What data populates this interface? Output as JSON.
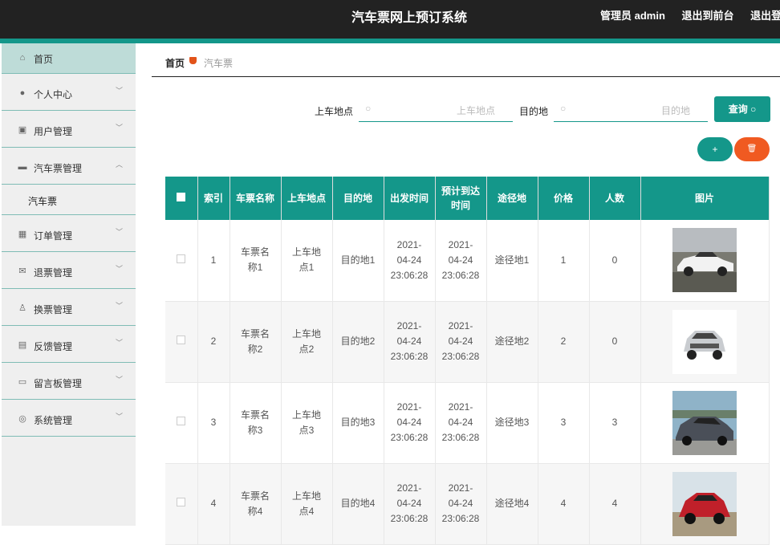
{
  "header": {
    "title": "汽车票网上预订系统",
    "admin_label": "管理员 admin",
    "back_front": "退出到前台",
    "logout": "退出登录"
  },
  "sidebar": {
    "items": [
      {
        "label": "首页",
        "icon": "home-icon"
      },
      {
        "label": "个人中心",
        "icon": "user-icon"
      },
      {
        "label": "用户管理",
        "icon": "clipboard-icon"
      },
      {
        "label": "汽车票管理",
        "icon": "chat-icon"
      },
      {
        "label": "订单管理",
        "icon": "grid-icon"
      },
      {
        "label": "退票管理",
        "icon": "mail-icon"
      },
      {
        "label": "换票管理",
        "icon": "person-icon"
      },
      {
        "label": "反馈管理",
        "icon": "document-icon"
      },
      {
        "label": "留言板管理",
        "icon": "message-icon"
      },
      {
        "label": "系统管理",
        "icon": "gear-icon"
      }
    ],
    "sub_item": "汽车票"
  },
  "breadcrumb": {
    "home": "首页",
    "current": "汽车票"
  },
  "search": {
    "field1_label": "上车地点",
    "field1_placeholder": "上车地点",
    "field2_label": "目的地",
    "field2_placeholder": "目的地",
    "query_label": "查询"
  },
  "actions": {
    "add_label": "+",
    "delete_label": "🗑"
  },
  "table": {
    "headers": [
      "索引",
      "车票名称",
      "上车地点",
      "目的地",
      "出发时间",
      "预计到达时间",
      "途径地",
      "价格",
      "人数",
      "图片"
    ],
    "rows": [
      {
        "index": "1",
        "name": "车票名称1",
        "from": "上车地点1",
        "to": "目的地1",
        "depart": "2021-04-24 23:06:28",
        "arrive": "2021-04-24 23:06:28",
        "via": "途径地1",
        "price": "1",
        "count": "0"
      },
      {
        "index": "2",
        "name": "车票名称2",
        "from": "上车地点2",
        "to": "目的地2",
        "depart": "2021-04-24 23:06:28",
        "arrive": "2021-04-24 23:06:28",
        "via": "途径地2",
        "price": "2",
        "count": "0"
      },
      {
        "index": "3",
        "name": "车票名称3",
        "from": "上车地点3",
        "to": "目的地3",
        "depart": "2021-04-24 23:06:28",
        "arrive": "2021-04-24 23:06:28",
        "via": "途径地3",
        "price": "3",
        "count": "3"
      },
      {
        "index": "4",
        "name": "车票名称4",
        "from": "上车地点4",
        "to": "目的地4",
        "depart": "2021-04-24 23:06:28",
        "arrive": "2021-04-24 23:06:28",
        "via": "途径地4",
        "price": "4",
        "count": "4"
      }
    ]
  },
  "colors": {
    "primary": "#14978a",
    "danger": "#f05a21",
    "header_bg": "#222222"
  }
}
